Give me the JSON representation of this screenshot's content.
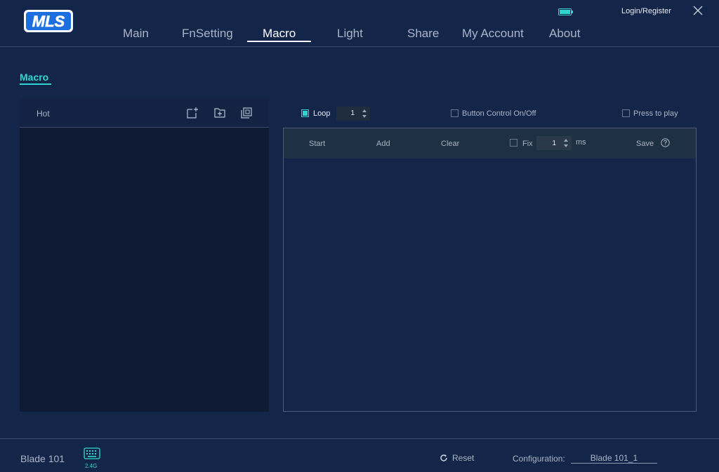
{
  "header": {
    "logo_text": "MLS",
    "login_label": "Login/Register",
    "nav": [
      {
        "label": "Main"
      },
      {
        "label": "FnSetting"
      },
      {
        "label": "Macro"
      },
      {
        "label": "Light"
      },
      {
        "label": "Share"
      },
      {
        "label": "My Account"
      },
      {
        "label": "About"
      }
    ],
    "active_tab": "Macro"
  },
  "section": {
    "title": "Macro"
  },
  "macro_list": {
    "header_label": "Hot",
    "tools": [
      "new-macro-icon",
      "add-folder-icon",
      "copy-icon"
    ]
  },
  "controls": {
    "loop_label": "Loop",
    "loop_checked": true,
    "loop_count": "1",
    "button_control_label": "Button Control On/Off",
    "button_control_checked": false,
    "press_to_play_label": "Press to play",
    "press_to_play_checked": false
  },
  "editor": {
    "start_label": "Start",
    "add_label": "Add",
    "clear_label": "Clear",
    "fix_label": "Fix",
    "fix_checked": false,
    "delay_value": "1",
    "delay_unit": "ms",
    "save_label": "Save"
  },
  "footer": {
    "device_name": "Blade 101",
    "connection": "2.4G",
    "reset_label": "Reset",
    "config_label": "Configuration:",
    "config_value": "Blade 101_1"
  },
  "colors": {
    "background": "#13264a",
    "accent": "#2fd6cf",
    "panel": "#0f1a33",
    "toolbar": "#1e3043"
  }
}
